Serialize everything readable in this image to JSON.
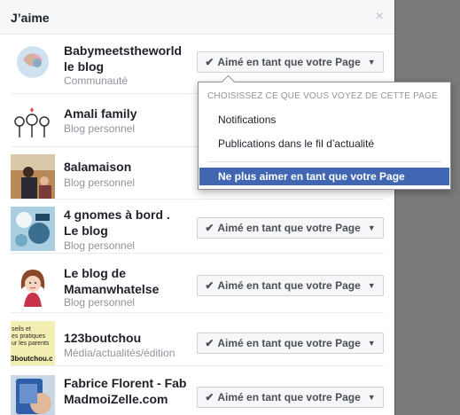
{
  "dialog": {
    "title": "J’aime",
    "close_glyph": "×"
  },
  "pages": [
    {
      "name": "Babymeetstheworld le blog",
      "category": "Communauté",
      "liked_label": "Aimé en tant que votre Page",
      "thumb": "avatar-heart"
    },
    {
      "name": "Amali family",
      "category": "Blog personnel",
      "liked_label": "",
      "thumb": "drawing"
    },
    {
      "name": "8alamaison",
      "category": "Blog personnel",
      "liked_label": "",
      "thumb": "photo"
    },
    {
      "name": "4 gnomes à bord . Le blog",
      "category": "Blog personnel",
      "liked_label": "Aimé en tant que votre Page",
      "thumb": "photo-blue"
    },
    {
      "name": "Le blog de Mamanwhatelse",
      "category": "Blog personnel",
      "liked_label": "Aimé en tant que votre Page",
      "thumb": "illustration"
    },
    {
      "name": "123boutchou",
      "category": "Média/actualités/édition",
      "liked_label": "Aimé en tant que votre Page",
      "thumb": "text-logo"
    },
    {
      "name": "Fabrice Florent - Fab MadmoiZelle.com",
      "category": "",
      "liked_label": "Aimé en tant que votre Page",
      "thumb": "photo-phone"
    }
  ],
  "thumb_texts": {
    "boutchou_line1": "seils et",
    "boutchou_line2": "es pratiques",
    "boutchou_line3": "ur les parents",
    "boutchou_url": "3boutchou.c"
  },
  "dropdown": {
    "heading": "CHOISISSEZ CE QUE VOUS VOYEZ DE CETTE PAGE",
    "items": [
      "Notifications",
      "Publications dans le fil d’actualité"
    ],
    "unlike": "Ne plus aimer en tant que votre Page"
  },
  "colors": {
    "accent": "#4267b2",
    "backdrop": "#7a7a7a",
    "header_bg": "#f6f7f9"
  }
}
